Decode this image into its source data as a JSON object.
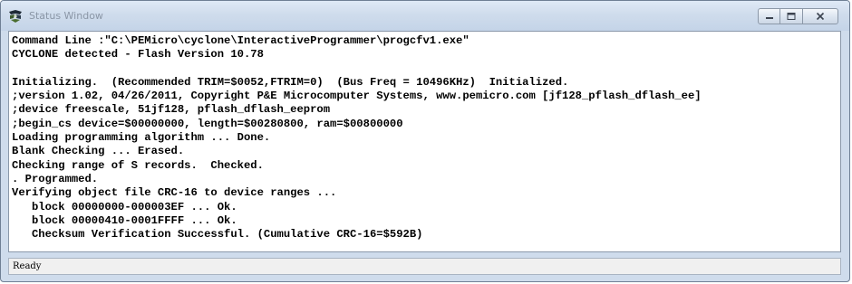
{
  "window": {
    "title": "Status Window",
    "controls": {
      "minimize": "minimize-icon",
      "maximize": "maximize-icon",
      "close": "close-icon"
    }
  },
  "console": {
    "lines": [
      "Command Line :\"C:\\PEMicro\\cyclone\\InteractiveProgrammer\\progcfv1.exe\"",
      "CYCLONE detected - Flash Version 10.78",
      "",
      "Initializing.  (Recommended TRIM=$0052,FTRIM=0)  (Bus Freq = 10496KHz)  Initialized.",
      ";version 1.02, 04/26/2011, Copyright P&E Microcomputer Systems, www.pemicro.com [jf128_pflash_dflash_ee]",
      ";device freescale, 51jf128, pflash_dflash_eeprom",
      ";begin_cs device=$00000000, length=$00280800, ram=$00800000",
      "Loading programming algorithm ... Done.",
      "Blank Checking ... Erased.",
      "Checking range of S records.  Checked.",
      ". Programmed.",
      "Verifying object file CRC-16 to device ranges ...",
      "   block 00000000-000003EF ... Ok.",
      "   block 00000410-0001FFFF ... Ok.",
      "   Checksum Verification Successful. (Cumulative CRC-16=$592B)"
    ]
  },
  "status": {
    "text": "Ready"
  },
  "colors": {
    "title_bar": "#cfdcec",
    "console_bg": "#ffffff",
    "title_text": "#8a96a6"
  }
}
